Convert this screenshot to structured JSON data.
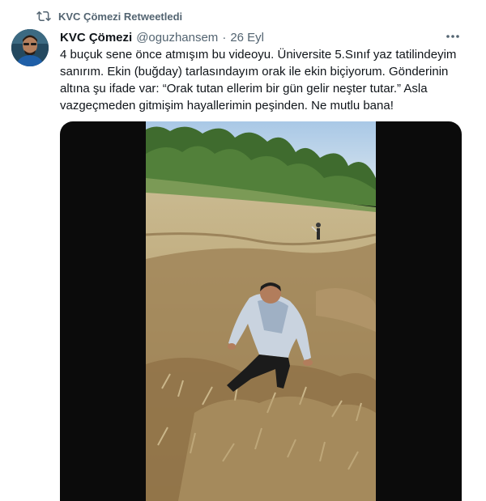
{
  "retweet": {
    "icon": "retweet-icon",
    "text": "KVC Çömezi Retweetledi"
  },
  "author": {
    "display_name": "KVC Çömezi",
    "handle": "@oguzhansem",
    "separator": "·",
    "date": "26 Eyl"
  },
  "tweet": {
    "lines": [
      "4 buçuk sene önce atmışım bu videoyu. Üniversite 5.Sınıf yaz tatilindeyim",
      "sanırım. Ekin (buğday) tarlasındayım orak ile ekin biçiyorum. Gönderinin",
      "altına şu ifade var: “Orak tutan ellerim bir gün gelir neşter tutar.” Asla",
      "vazgeçmeden gitmişim hayallerimin peşinden. Ne mutlu bana!"
    ]
  },
  "colors": {
    "text_primary": "#0f1419",
    "text_secondary": "#536471",
    "media_background": "#0b0b0b"
  },
  "icons": {
    "more": "more-horizontal-icon",
    "retweet": "retweet-icon"
  }
}
